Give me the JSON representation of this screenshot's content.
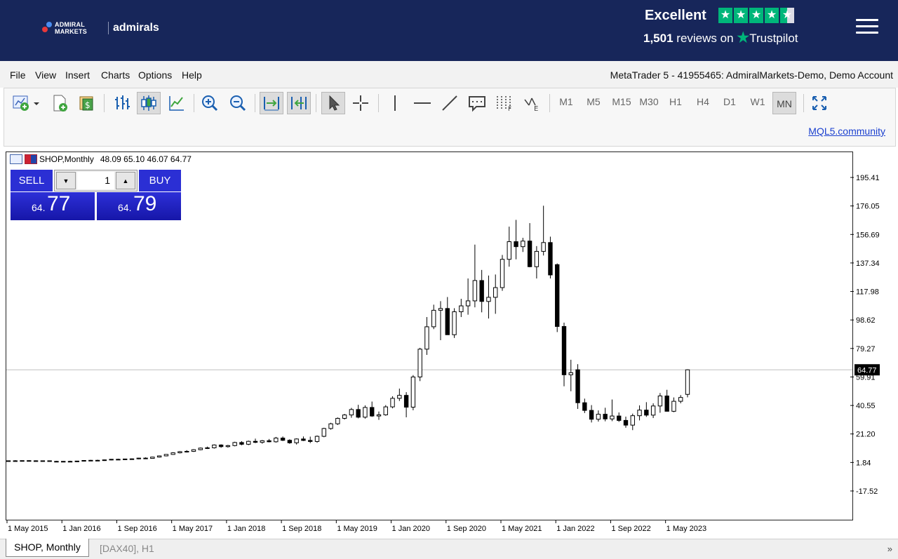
{
  "header": {
    "logo_small": "ADMIRAL MARKETS",
    "logo_big": "admirals",
    "rating_word": "Excellent",
    "reviews_count": "1,501",
    "reviews_text": "reviews on",
    "trustpilot": "Trustpilot",
    "stars": 4.5
  },
  "menu": [
    "File",
    "View",
    "Insert",
    "Charts",
    "Options",
    "Help"
  ],
  "account_title": "MetaTrader 5 - 41955465: AdmiralMarkets-Demo, Demo Account",
  "toolbar": {
    "timeframes": [
      "M1",
      "M5",
      "M15",
      "M30",
      "H1",
      "H4",
      "D1",
      "W1",
      "MN"
    ],
    "active_timeframe": "MN",
    "community_link": "MQL5.community"
  },
  "chart_info": {
    "symbol": "SHOP,Monthly",
    "ohlc": "48.09 65.10 46.07 64.77"
  },
  "one_click": {
    "sell_label": "SELL",
    "buy_label": "BUY",
    "volume": "1",
    "sell_big": "64.",
    "sell_small": "77",
    "buy_big": "64.",
    "buy_small": "79"
  },
  "chart_data": {
    "type": "candlestick",
    "title": "SHOP,Monthly",
    "current_price": 64.77,
    "current_price_label": "64.77",
    "y_ticks": [
      195.41,
      176.05,
      156.69,
      137.34,
      117.98,
      98.62,
      79.27,
      59.91,
      40.55,
      21.2,
      1.84,
      -17.52
    ],
    "y_tick_labels": [
      "195.41",
      "176.05",
      "156.69",
      "137.34",
      "117.98",
      "98.62",
      "79.27",
      "59.91",
      "40.55",
      "21.20",
      "1.84",
      "-17.52"
    ],
    "x_labels": [
      "1 May 2015",
      "1 Jan 2016",
      "1 Sep 2016",
      "1 May 2017",
      "1 Jan 2018",
      "1 Sep 2018",
      "1 May 2019",
      "1 Jan 2020",
      "1 Sep 2020",
      "1 May 2021",
      "1 Jan 2022",
      "1 Sep 2022",
      "1 May 2023"
    ],
    "candles": [
      [
        2.8,
        3.2,
        2.5,
        3.0
      ],
      [
        3.0,
        3.4,
        2.6,
        2.9
      ],
      [
        2.9,
        3.2,
        2.6,
        3.1
      ],
      [
        3.1,
        3.3,
        2.8,
        3.0
      ],
      [
        3.0,
        3.3,
        2.6,
        2.8
      ],
      [
        2.8,
        3.1,
        2.5,
        3.0
      ],
      [
        3.0,
        3.2,
        2.5,
        2.6
      ],
      [
        2.6,
        2.9,
        2.1,
        2.3
      ],
      [
        2.3,
        2.8,
        2.0,
        2.6
      ],
      [
        2.6,
        3.0,
        2.2,
        2.4
      ],
      [
        2.4,
        2.9,
        2.1,
        2.8
      ],
      [
        2.8,
        3.3,
        2.5,
        3.2
      ],
      [
        3.2,
        3.6,
        2.9,
        3.3
      ],
      [
        3.3,
        3.7,
        2.9,
        3.2
      ],
      [
        3.2,
        3.8,
        2.9,
        3.6
      ],
      [
        3.6,
        4.2,
        3.3,
        4.0
      ],
      [
        4.0,
        4.4,
        3.6,
        3.9
      ],
      [
        3.9,
        4.4,
        3.6,
        4.2
      ],
      [
        4.2,
        4.6,
        3.9,
        4.3
      ],
      [
        4.3,
        5.0,
        4.0,
        4.8
      ],
      [
        4.8,
        5.3,
        4.4,
        4.6
      ],
      [
        4.6,
        5.7,
        4.4,
        5.5
      ],
      [
        5.5,
        6.6,
        5.2,
        6.3
      ],
      [
        6.3,
        7.5,
        6.0,
        7.3
      ],
      [
        7.3,
        8.8,
        7.0,
        8.4
      ],
      [
        8.4,
        9.6,
        8.0,
        9.2
      ],
      [
        9.2,
        10.2,
        8.6,
        9.4
      ],
      [
        9.4,
        10.9,
        9.0,
        10.5
      ],
      [
        10.5,
        12.0,
        10.1,
        11.6
      ],
      [
        11.6,
        12.6,
        11.0,
        11.8
      ],
      [
        11.8,
        14.1,
        11.3,
        13.7
      ],
      [
        13.7,
        14.2,
        11.8,
        12.6
      ],
      [
        12.6,
        13.8,
        11.9,
        13.3
      ],
      [
        13.3,
        15.9,
        12.8,
        15.4
      ],
      [
        15.4,
        16.3,
        13.5,
        14.2
      ],
      [
        14.2,
        16.7,
        13.6,
        16.2
      ],
      [
        16.2,
        18.0,
        15.0,
        15.5
      ],
      [
        15.5,
        17.1,
        14.6,
        16.6
      ],
      [
        16.6,
        17.8,
        15.5,
        15.9
      ],
      [
        15.9,
        19.2,
        15.3,
        18.4
      ],
      [
        18.4,
        19.5,
        16.4,
        16.9
      ],
      [
        16.9,
        17.6,
        14.5,
        15.2
      ],
      [
        15.2,
        18.2,
        14.0,
        17.8
      ],
      [
        17.8,
        19.5,
        16.4,
        16.8
      ],
      [
        16.8,
        19.4,
        15.0,
        16.1
      ],
      [
        16.1,
        20.2,
        15.2,
        19.6
      ],
      [
        19.6,
        25.4,
        19.0,
        24.9
      ],
      [
        24.9,
        28.8,
        24.1,
        28.1
      ],
      [
        28.1,
        32.4,
        27.3,
        31.8
      ],
      [
        31.8,
        34.8,
        31.0,
        34.1
      ],
      [
        34.1,
        38.9,
        32.2,
        37.8
      ],
      [
        37.8,
        41.0,
        31.8,
        32.6
      ],
      [
        32.6,
        40.6,
        31.6,
        39.2
      ],
      [
        39.2,
        43.2,
        32.8,
        33.4
      ],
      [
        33.4,
        36.4,
        30.8,
        34.2
      ],
      [
        34.2,
        40.8,
        33.6,
        39.6
      ],
      [
        39.6,
        46.8,
        38.6,
        45.4
      ],
      [
        45.4,
        52.0,
        43.6,
        47.4
      ],
      [
        47.4,
        49.6,
        32.5,
        39.4
      ],
      [
        39.4,
        61.2,
        37.3,
        59.9
      ],
      [
        59.9,
        79.7,
        57.1,
        78.8
      ],
      [
        78.8,
        100.6,
        74.9,
        94.0
      ],
      [
        94.0,
        109.0,
        92.4,
        105.2
      ],
      [
        105.2,
        111.4,
        84.9,
        106.4
      ],
      [
        106.4,
        114.2,
        89.0,
        88.6
      ],
      [
        88.6,
        106.6,
        86.4,
        104.2
      ],
      [
        104.2,
        113.0,
        100.6,
        108.2
      ],
      [
        108.2,
        126.8,
        102.2,
        111.6
      ],
      [
        111.6,
        149.8,
        107.2,
        125.4
      ],
      [
        125.4,
        132.6,
        103.8,
        111.2
      ],
      [
        111.2,
        128.8,
        99.6,
        114.0
      ],
      [
        114.0,
        129.5,
        102.8,
        120.6
      ],
      [
        120.6,
        142.8,
        118.4,
        139.8
      ],
      [
        139.8,
        162.0,
        134.8,
        151.8
      ],
      [
        151.8,
        166.6,
        139.8,
        148.4
      ],
      [
        148.4,
        154.4,
        144.8,
        152.2
      ],
      [
        152.2,
        164.4,
        134.4,
        134.8
      ],
      [
        134.8,
        148.8,
        126.8,
        145.2
      ],
      [
        145.2,
        176.2,
        142.4,
        151.2
      ],
      [
        151.2,
        155.2,
        126.8,
        129.2
      ],
      [
        136.2,
        137.0,
        90.4,
        94.2
      ],
      [
        94.2,
        96.8,
        53.6,
        61.4
      ],
      [
        61.4,
        71.6,
        50.2,
        62.8
      ],
      [
        64.8,
        68.6,
        38.2,
        42.4
      ],
      [
        42.4,
        45.2,
        35.4,
        37.2
      ],
      [
        37.2,
        40.8,
        29.0,
        31.2
      ],
      [
        31.2,
        37.2,
        29.6,
        34.6
      ],
      [
        34.6,
        39.0,
        29.8,
        31.4
      ],
      [
        31.4,
        44.6,
        29.9,
        33.4
      ],
      [
        33.4,
        35.8,
        29.4,
        30.4
      ],
      [
        30.4,
        33.0,
        25.4,
        27.2
      ],
      [
        27.2,
        35.0,
        23.8,
        33.6
      ],
      [
        33.6,
        40.6,
        30.4,
        37.4
      ],
      [
        37.4,
        42.8,
        32.8,
        34.0
      ],
      [
        34.0,
        42.0,
        32.0,
        40.2
      ],
      [
        40.2,
        49.0,
        35.6,
        47.0
      ],
      [
        47.0,
        51.2,
        36.8,
        36.6
      ],
      [
        36.6,
        46.0,
        36.0,
        43.4
      ],
      [
        43.4,
        47.6,
        42.0,
        46.0
      ],
      [
        48.09,
        65.1,
        46.07,
        64.77
      ]
    ]
  },
  "tabs": {
    "active": "SHOP, Monthly",
    "inactive": "[DAX40], H1",
    "scroll": "»"
  },
  "colors": {
    "header_bg": "#17265a",
    "trustpilot_green": "#00b67a",
    "oneclick_blue": "#2b2fd4",
    "link": "#1a3fcf"
  }
}
